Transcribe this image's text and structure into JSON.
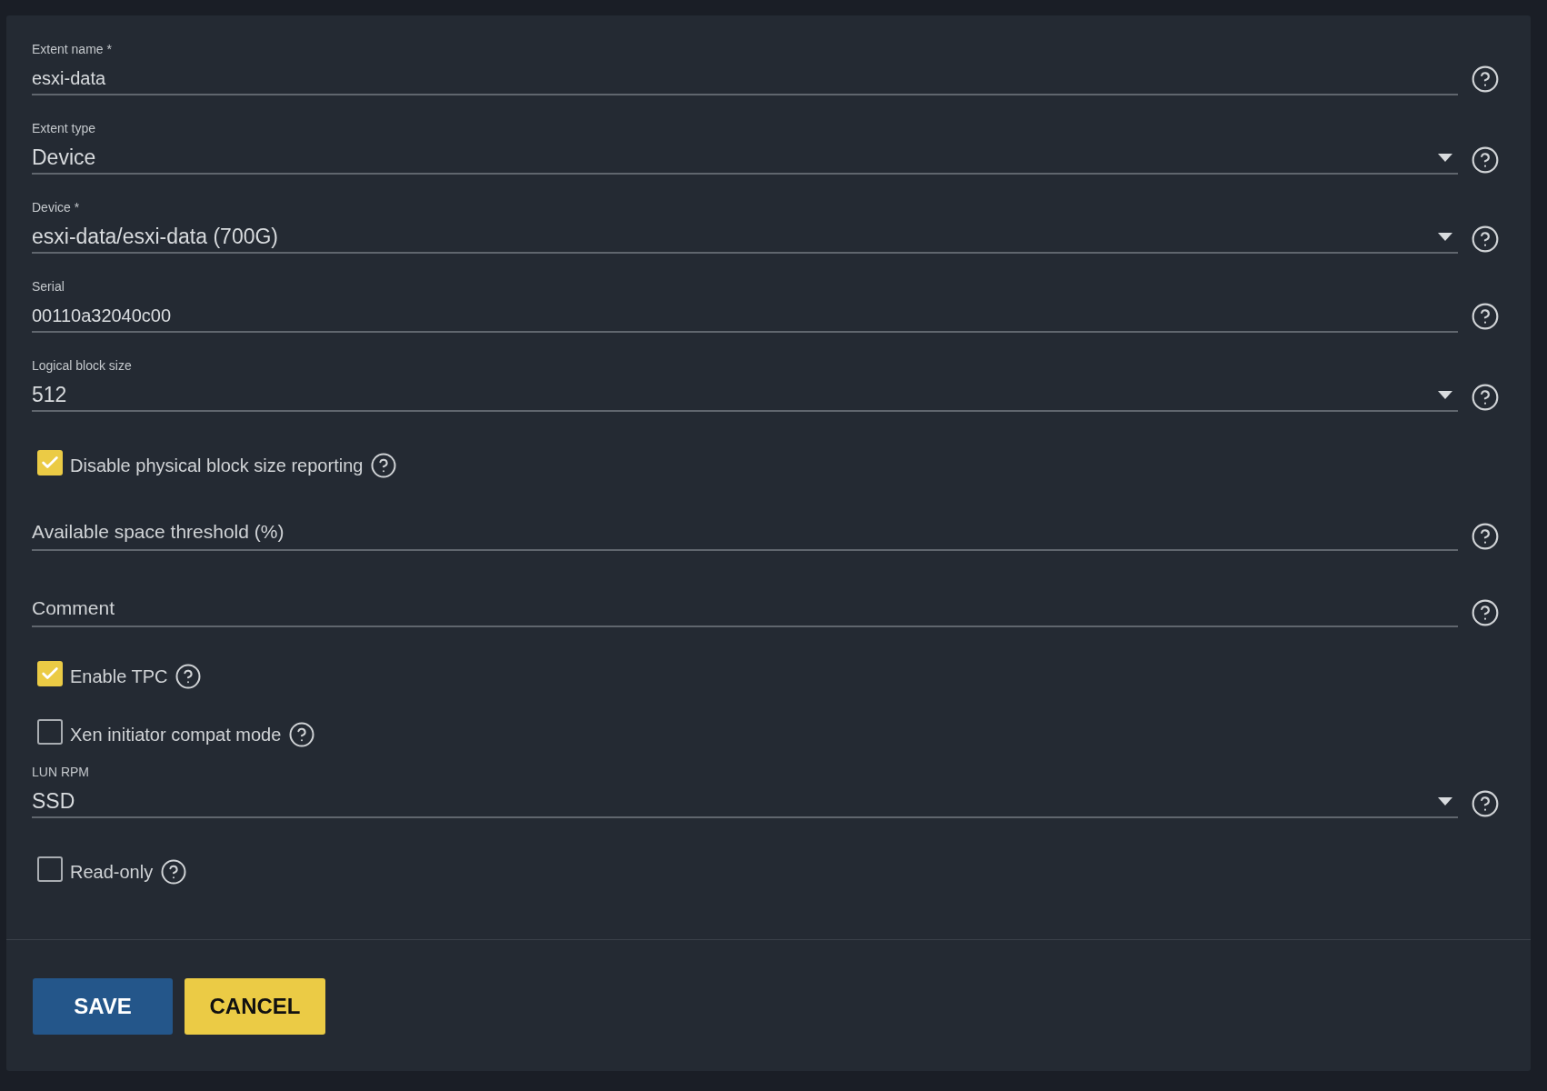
{
  "fields": [
    {
      "kind": "text",
      "label": "Extent name *",
      "value": "esxi-data"
    },
    {
      "kind": "select",
      "label": "Extent type",
      "value": "Device"
    },
    {
      "kind": "select",
      "label": "Device *",
      "value": "esxi-data/esxi-data (700G)"
    },
    {
      "kind": "text",
      "label": "Serial",
      "value": "00110a32040c00"
    },
    {
      "kind": "select",
      "label": "Logical block size",
      "value": "512"
    },
    {
      "kind": "checkbox",
      "label": "Disable physical block size reporting",
      "checked": true
    },
    {
      "kind": "empty",
      "placeholder": "Available space threshold (%)"
    },
    {
      "kind": "empty",
      "placeholder": "Comment"
    },
    {
      "kind": "checkbox",
      "label": "Enable TPC",
      "checked": true
    },
    {
      "kind": "checkbox",
      "label": "Xen initiator compat mode",
      "checked": false
    },
    {
      "kind": "select",
      "label": "LUN RPM",
      "value": "SSD"
    },
    {
      "kind": "checkbox",
      "label": "Read-only",
      "checked": false
    }
  ],
  "buttons": [
    {
      "kind": "primary",
      "label": "SAVE"
    },
    {
      "kind": "secondary",
      "label": "CANCEL"
    }
  ]
}
